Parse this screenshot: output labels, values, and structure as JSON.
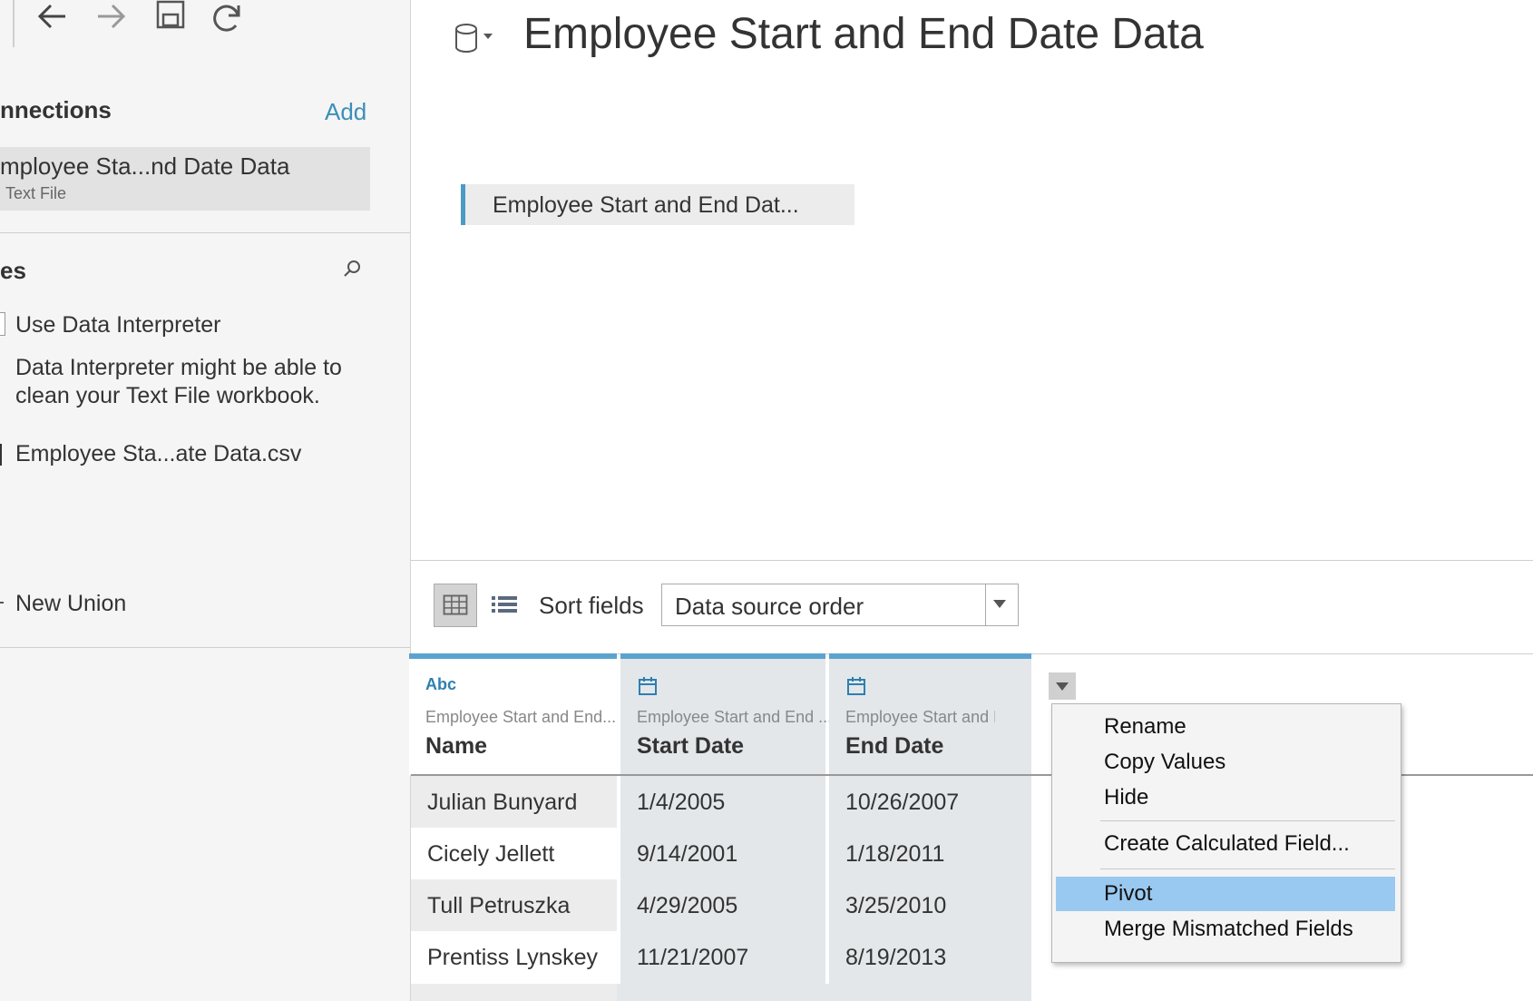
{
  "left_panel": {
    "connections_title": "nnections",
    "add_label": "Add",
    "connection": {
      "name": "mployee Sta...nd Date Data",
      "type": "Text File"
    },
    "files_title": "es",
    "data_interpreter": {
      "label": "Use Data Interpreter",
      "description": "Data Interpreter might be able to clean your Text File workbook."
    },
    "file_item": "Employee Sta...ate Data.csv",
    "new_union": "New Union"
  },
  "canvas": {
    "title": "Employee Start and End Date Data",
    "table_pill": "Employee Start and End Dat..."
  },
  "grid_toolbar": {
    "sort_label": "Sort fields",
    "sort_value": "Data source order"
  },
  "grid": {
    "columns": [
      {
        "type_label": "Abc",
        "source": "Employee Start and End...",
        "name": "Name"
      },
      {
        "type_label": "",
        "source": "Employee Start and End ...",
        "name": "Start Date"
      },
      {
        "type_label": "",
        "source": "Employee Start and E",
        "name": "End Date"
      }
    ],
    "rows": [
      [
        "Julian Bunyard",
        "1/4/2005",
        "10/26/2007"
      ],
      [
        "Cicely Jellett",
        "9/14/2001",
        "1/18/2011"
      ],
      [
        "Tull Petruszka",
        "4/29/2005",
        "3/25/2010"
      ],
      [
        "Prentiss Lynskey",
        "11/21/2007",
        "8/19/2013"
      ]
    ]
  },
  "context_menu": {
    "items": [
      "Rename",
      "Copy Values",
      "Hide",
      "Create Calculated Field...",
      "Pivot",
      "Merge Mismatched Fields"
    ],
    "highlighted": "Pivot"
  },
  "colors": {
    "accent": "#5ba3cf",
    "link": "#3b8fb8",
    "highlight": "#99c9f0",
    "date_column_bg": "#e3e7ea"
  }
}
